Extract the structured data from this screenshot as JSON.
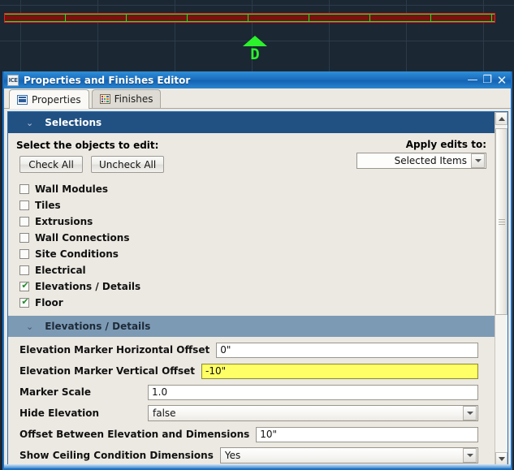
{
  "viewport": {
    "name": "cad-viewport",
    "marker_label": "D",
    "grid_color": "#2c3b4a",
    "background": "#1b2733",
    "wall_fill": "#7c1010",
    "wall_outline": "#e02020",
    "marker_color": "#2bf22b"
  },
  "window": {
    "title": "Properties and Finishes Editor",
    "app_icon_text": "ICE",
    "minimize_label": "—",
    "maximize_label": "❐",
    "close_label": "✕",
    "border_color": "#1d6fc0"
  },
  "tabs": [
    {
      "label": "Properties",
      "icon": "list-icon",
      "active": true
    },
    {
      "label": "Finishes",
      "icon": "color-swatch-icon",
      "active": false
    }
  ],
  "selections": {
    "header": "Selections",
    "chevron": "⌄",
    "instruction": "Select the objects to edit:",
    "check_all_label": "Check All",
    "uncheck_all_label": "Uncheck All",
    "apply_edits_label": "Apply edits to:",
    "apply_edits_value": "Selected Items",
    "items": [
      {
        "label": "Wall Modules",
        "checked": false
      },
      {
        "label": "Tiles",
        "checked": false
      },
      {
        "label": "Extrusions",
        "checked": false
      },
      {
        "label": "Wall Connections",
        "checked": false
      },
      {
        "label": "Site Conditions",
        "checked": false
      },
      {
        "label": "Electrical",
        "checked": false
      },
      {
        "label": "Elevations / Details",
        "checked": true
      },
      {
        "label": "Floor",
        "checked": true
      }
    ]
  },
  "elevations": {
    "header": "Elevations / Details",
    "chevron": "⌄",
    "fields": [
      {
        "label": "Elevation Marker Horizontal Offset",
        "value": "0\"",
        "type": "text",
        "highlight": false
      },
      {
        "label": "Elevation Marker Vertical Offset",
        "value": "-10\"",
        "type": "text",
        "highlight": true
      },
      {
        "label": "Marker Scale",
        "value": "1.0",
        "type": "text",
        "highlight": false
      },
      {
        "label": "Hide Elevation",
        "value": "false",
        "type": "combo",
        "highlight": false
      },
      {
        "label": "Offset Between Elevation and Dimensions",
        "value": "10\"",
        "type": "text",
        "highlight": false
      },
      {
        "label": "Show Ceiling Condition Dimensions",
        "value": "Yes",
        "type": "combo",
        "highlight": false
      }
    ]
  },
  "scrollbar": {
    "up_arrow": "▲",
    "down_arrow": "▼"
  }
}
